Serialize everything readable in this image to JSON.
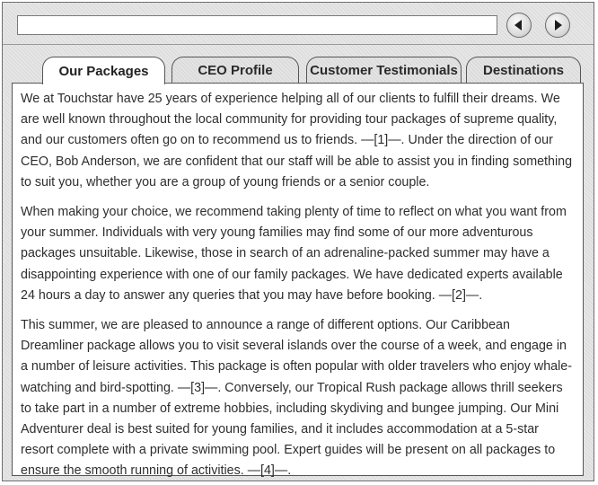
{
  "nav": {
    "address_value": "",
    "back_icon": "arrow-left-icon",
    "forward_icon": "arrow-right-icon"
  },
  "tabs": [
    {
      "label": "Our Packages",
      "active": true
    },
    {
      "label": "CEO Profile",
      "active": false
    },
    {
      "label": "Customer Testimonials",
      "active": false
    },
    {
      "label": "Destinations",
      "active": false
    }
  ],
  "content": {
    "paragraphs": [
      "We at Touchstar have 25 years of experience helping all of our clients to fulfill their dreams. We are well known throughout the local community for providing tour packages of supreme quality, and our customers often go on to recommend us to friends. —[1]—. Under the direction of our CEO, Bob Anderson, we are confident that our staff will be able to assist you in finding something to suit you, whether you are a group of young friends or a senior couple.",
      "When making your choice, we recommend taking plenty of time to reflect on what you want from your summer. Individuals with very young families may find some of our more adventurous packages unsuitable. Likewise, those in search of an adrenaline-packed summer may have a disappointing experience with one of our family packages. We have dedicated experts available 24 hours a day to answer any queries that you may have before booking. —[2]—.",
      "This summer, we are pleased to announce a range of different options. Our Caribbean Dreamliner package allows you to visit several islands over the course of a week, and engage in a number of leisure activities. This package is often popular with older travelers who enjoy whale-watching and bird-spotting. —[3]—. Conversely, our Tropical Rush package allows thrill seekers to take part in a number of extreme hobbies, including skydiving and bungee jumping. Our Mini Adventurer deal is best suited for young families, and it includes accommodation at a 5-star resort complete with a private swimming pool. Expert guides will be present on all packages to ensure the smooth running of activities. —[4]—."
    ]
  }
}
